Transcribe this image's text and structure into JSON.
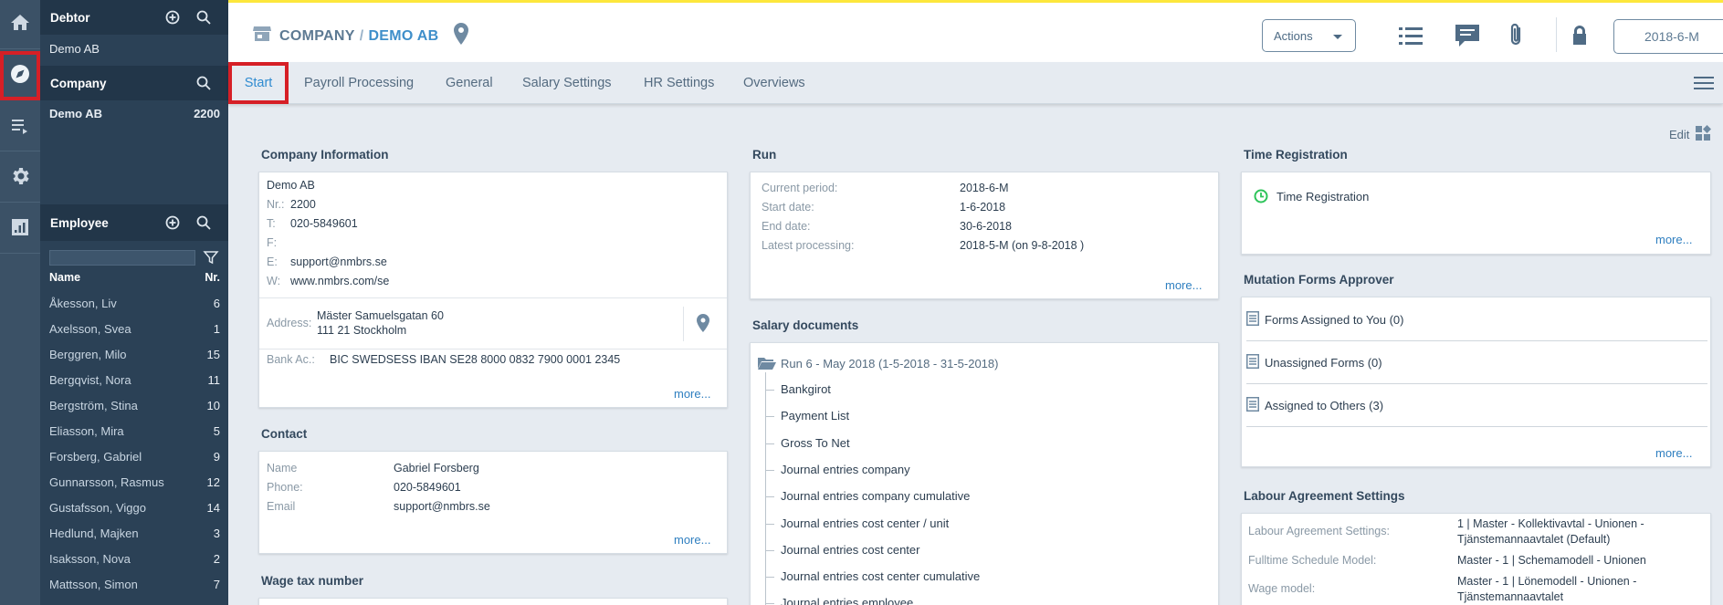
{
  "side": {
    "debtor": {
      "title": "Debtor",
      "name": "Demo AB"
    },
    "company": {
      "title": "Company",
      "name": "Demo AB",
      "number": "2200"
    },
    "employee": {
      "title": "Employee",
      "col_name": "Name",
      "col_nr": "Nr.",
      "items": [
        {
          "name": "Åkesson, Liv",
          "nr": "6"
        },
        {
          "name": "Axelsson, Svea",
          "nr": "1"
        },
        {
          "name": "Berggren, Milo",
          "nr": "15"
        },
        {
          "name": "Bergqvist, Nora",
          "nr": "11"
        },
        {
          "name": "Bergström, Stina",
          "nr": "10"
        },
        {
          "name": "Eliasson, Mira",
          "nr": "5"
        },
        {
          "name": "Forsberg, Gabriel",
          "nr": "9"
        },
        {
          "name": "Gunnarsson, Rasmus",
          "nr": "12"
        },
        {
          "name": "Gustafsson, Viggo",
          "nr": "14"
        },
        {
          "name": "Hedlund, Majken",
          "nr": "3"
        },
        {
          "name": "Isaksson, Nova",
          "nr": "2"
        },
        {
          "name": "Mattsson, Simon",
          "nr": "7"
        }
      ]
    }
  },
  "header": {
    "crumb1": "COMPANY",
    "sep": "/",
    "crumb2": "DEMO AB",
    "actions": "Actions",
    "period": "2018-6-M"
  },
  "tabs": [
    "Start",
    "Payroll Processing",
    "General",
    "Salary Settings",
    "HR Settings",
    "Overviews"
  ],
  "edit": "Edit",
  "company_info": {
    "title": "Company Information",
    "name": "Demo AB",
    "nr_l": "Nr.:",
    "nr": "2200",
    "t_l": "T:",
    "t": "020-5849601",
    "f_l": "F:",
    "e_l": "E:",
    "e": "support@nmbrs.se",
    "w_l": "W:",
    "w": "www.nmbrs.com/se",
    "addr_l": "Address:",
    "addr1": "Mäster Samuelsgatan 60",
    "addr2": "111 21 Stockholm",
    "bank_l": "Bank Ac.:",
    "bank": "BIC SWEDSESS IBAN SE28 8000 0832 7900 0001 2345",
    "more": "more..."
  },
  "contact": {
    "title": "Contact",
    "name_l": "Name",
    "name": "Gabriel Forsberg",
    "phone_l": "Phone:",
    "phone": "020-5849601",
    "email_l": "Email",
    "email": "support@nmbrs.se",
    "more": "more..."
  },
  "wage_tax": {
    "title": "Wage tax number"
  },
  "run": {
    "title": "Run",
    "cp_l": "Current period:",
    "cp": "2018-6-M",
    "sd_l": "Start date:",
    "sd": "1-6-2018",
    "ed_l": "End date:",
    "ed": "30-6-2018",
    "lp_l": "Latest processing:",
    "lp": "2018-5-M (on 9-8-2018 )",
    "more": "more..."
  },
  "salary_docs": {
    "title": "Salary documents",
    "folder": "Run 6 - May 2018 (1-5-2018 - 31-5-2018)",
    "items": [
      "Bankgirot",
      "Payment List",
      "Gross To Net",
      "Journal entries company",
      "Journal entries company cumulative",
      "Journal entries cost center / unit",
      "Journal entries cost center",
      "Journal entries cost center cumulative",
      "Journal entries employee"
    ]
  },
  "time_reg": {
    "title": "Time Registration",
    "item": "Time Registration",
    "more": "more..."
  },
  "mutation": {
    "title": "Mutation Forms Approver",
    "items": [
      "Forms Assigned to You (0)",
      "Unassigned Forms (0)",
      "Assigned to Others (3)"
    ],
    "more": "more..."
  },
  "labour": {
    "title": "Labour Agreement Settings",
    "l1": "Labour Agreement Settings:",
    "v1a": "1 | Master - Kollektivavtal - Unionen -",
    "v1b": "Tjänstemannaavtalet (Default)",
    "l2": "Fulltime Schedule Model:",
    "v2": "Master - 1 | Schemamodell - Unionen",
    "l3": "Wage model:",
    "v3a": "Master - 1 | Lönemodell - Unionen -",
    "v3b": "Tjänstemannaavtalet"
  }
}
